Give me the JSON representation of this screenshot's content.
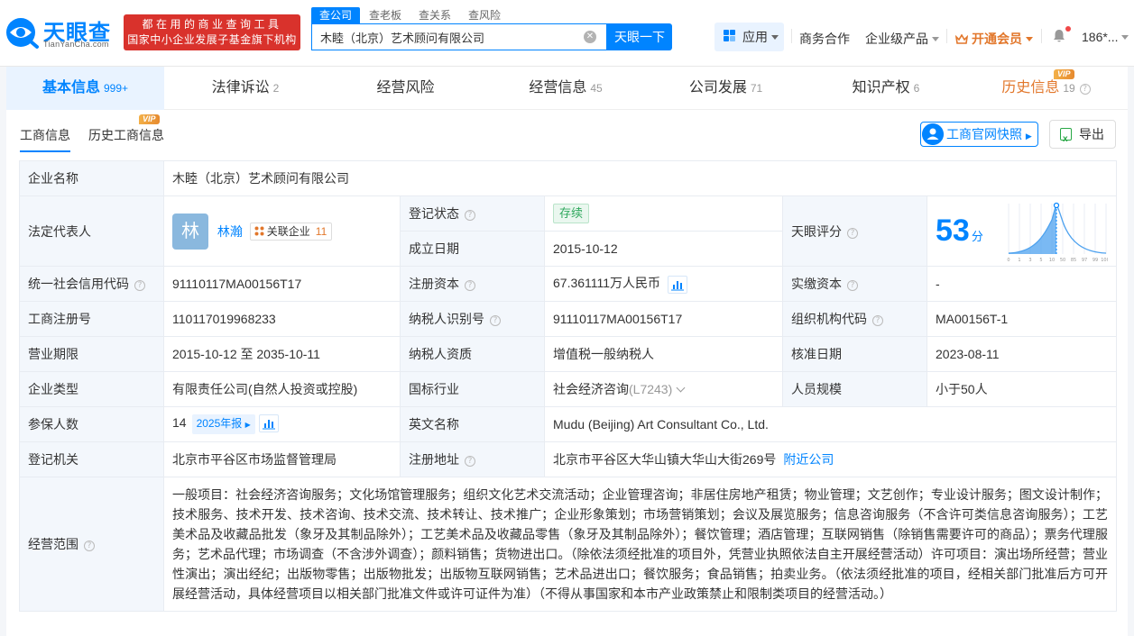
{
  "brand": {
    "logo_text": "天眼查",
    "logo_sub": "TianYanCha.com",
    "slogan_line1": "都在用的商业查询工具",
    "slogan_line2": "国家中小企业发展子基金旗下机构"
  },
  "search": {
    "tabs": [
      "查公司",
      "查老板",
      "查关系",
      "查风险"
    ],
    "value": "木睦（北京）艺术顾问有限公司",
    "button": "天眼一下"
  },
  "nav": {
    "apps": "应用",
    "business": "商务合作",
    "enterprise": "企业级产品",
    "vip": "开通会员",
    "user": "186*..."
  },
  "main_tabs": [
    {
      "label": "基本信息",
      "count": "999+"
    },
    {
      "label": "法律诉讼",
      "count": "2"
    },
    {
      "label": "经营风险",
      "count": ""
    },
    {
      "label": "经营信息",
      "count": "45"
    },
    {
      "label": "公司发展",
      "count": "71"
    },
    {
      "label": "知识产权",
      "count": "6"
    },
    {
      "label": "历史信息",
      "count": "19"
    }
  ],
  "vip_label": "VIP",
  "sub_tabs": [
    "工商信息",
    "历史工商信息"
  ],
  "actions": {
    "snapshot": "工商官网快照",
    "export": "导出"
  },
  "info": {
    "company_name_label": "企业名称",
    "company_name": "木睦（北京）艺术顾问有限公司",
    "legal_rep_label": "法定代表人",
    "legal_rep_avatar": "林",
    "legal_rep": "林瀚",
    "related_label": "关联企业",
    "related_count": "11",
    "status_label": "登记状态",
    "status": "存续",
    "founded_label": "成立日期",
    "founded": "2015-10-12",
    "score_label": "天眼评分",
    "score": "53",
    "score_unit": "分",
    "score_axis": [
      "0",
      "1",
      "3",
      "5",
      "10",
      "50",
      "85",
      "97",
      "99",
      "100"
    ],
    "credit_code_label": "统一社会信用代码",
    "credit_code": "91110117MA00156T17",
    "reg_capital_label": "注册资本",
    "reg_capital": "67.361111万人民币",
    "paid_capital_label": "实缴资本",
    "paid_capital": "-",
    "reg_no_label": "工商注册号",
    "reg_no": "110117019968233",
    "taxpayer_id_label": "纳税人识别号",
    "taxpayer_id": "91110117MA00156T17",
    "org_code_label": "组织机构代码",
    "org_code": "MA00156T-1",
    "term_label": "营业期限",
    "term": "2015-10-12 至 2035-10-11",
    "tax_quality_label": "纳税人资质",
    "tax_quality": "增值税一般纳税人",
    "approval_date_label": "核准日期",
    "approval_date": "2023-08-11",
    "type_label": "企业类型",
    "type": "有限责任公司(自然人投资或控股)",
    "industry_label": "国标行业",
    "industry": "社会经济咨询",
    "industry_code": "(L7243)",
    "staff_size_label": "人员规模",
    "staff_size": "小于50人",
    "insured_label": "参保人数",
    "insured": "14",
    "insured_report": "2025年报",
    "english_name_label": "英文名称",
    "english_name": "Mudu (Beijing) Art Consultant Co., Ltd.",
    "authority_label": "登记机关",
    "authority": "北京市平谷区市场监督管理局",
    "address_label": "注册地址",
    "address": "北京市平谷区大华山镇大华山大街269号",
    "nearby": "附近公司",
    "scope_label": "经营范围",
    "scope": "一般项目：社会经济咨询服务；文化场馆管理服务；组织文化艺术交流活动；企业管理咨询；非居住房地产租赁；物业管理；文艺创作；专业设计服务；图文设计制作；技术服务、技术开发、技术咨询、技术交流、技术转让、技术推广；企业形象策划；市场营销策划；会议及展览服务；信息咨询服务（不含许可类信息咨询服务）；工艺美术品及收藏品批发（象牙及其制品除外）；工艺美术品及收藏品零售（象牙及其制品除外）；餐饮管理；酒店管理；互联网销售（除销售需要许可的商品）；票务代理服务；艺术品代理；市场调查（不含涉外调查）；颜料销售；货物进出口。（除依法须经批准的项目外，凭营业执照依法自主开展经营活动）许可项目：演出场所经营；营业性演出；演出经纪；出版物零售；出版物批发；出版物互联网销售；艺术品进出口；餐饮服务；食品销售；拍卖业务。（依法须经批准的项目，经相关部门批准后方可开展经营活动，具体经营项目以相关部门批准文件或许可证件为准）（不得从事国家和本市产业政策禁止和限制类项目的经营活动。）"
  },
  "colors": {
    "primary": "#0084ff",
    "slogan_bg": "#d9322c",
    "vip": "#e2772b",
    "status_green": "#2fa85d",
    "label_bg": "#f3f7fc"
  }
}
